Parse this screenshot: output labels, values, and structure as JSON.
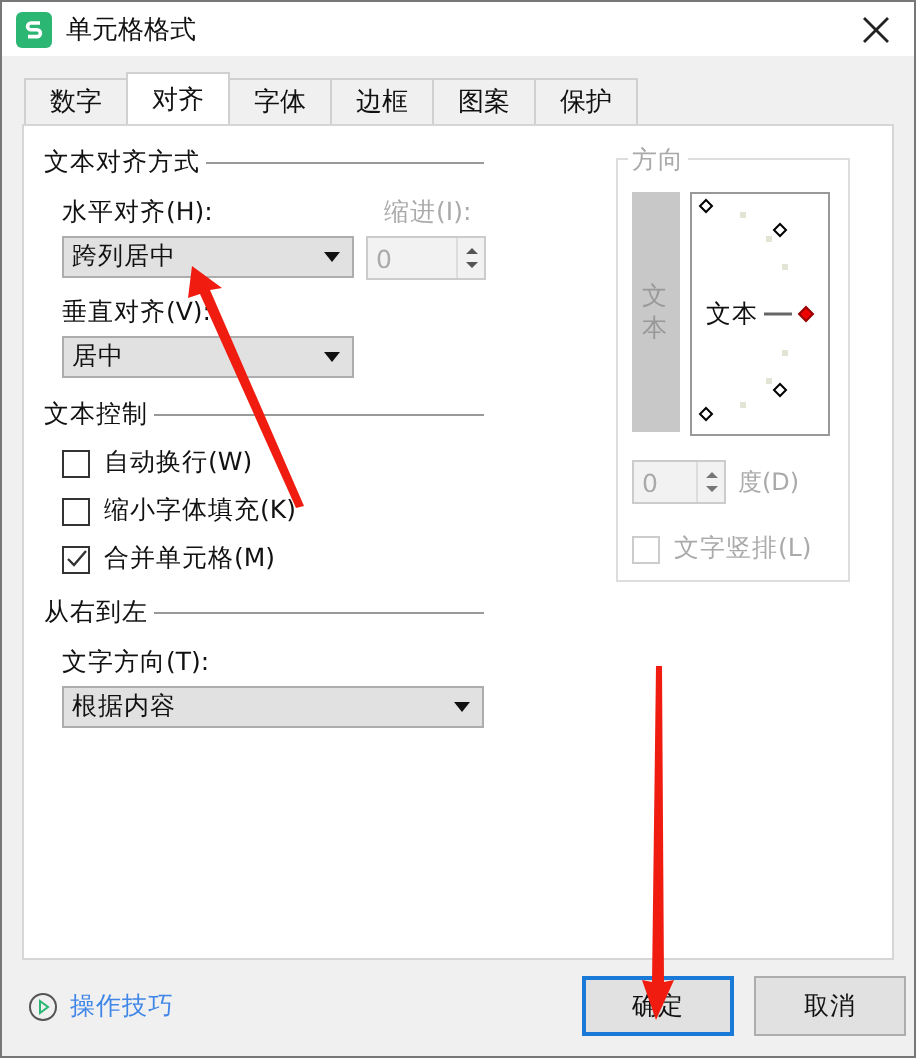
{
  "window": {
    "title": "单元格格式"
  },
  "tabs": [
    {
      "label": "数字",
      "selected": false
    },
    {
      "label": "对齐",
      "selected": true
    },
    {
      "label": "字体",
      "selected": false
    },
    {
      "label": "边框",
      "selected": false
    },
    {
      "label": "图案",
      "selected": false
    },
    {
      "label": "保护",
      "selected": false
    }
  ],
  "alignment": {
    "title": "文本对齐方式",
    "horizontal": {
      "label": "水平对齐(H):",
      "value": "跨列居中"
    },
    "indent": {
      "label": "缩进(I):",
      "value": "0",
      "disabled": true
    },
    "vertical": {
      "label": "垂直对齐(V):",
      "value": "居中"
    }
  },
  "text_control": {
    "title": "文本控制",
    "options": [
      {
        "label": "自动换行(W)",
        "checked": false
      },
      {
        "label": "缩小字体填充(K)",
        "checked": false
      },
      {
        "label": "合并单元格(M)",
        "checked": true
      }
    ]
  },
  "right_to_left": {
    "title": "从右到左",
    "direction": {
      "label": "文字方向(T):",
      "value": "根据内容"
    }
  },
  "orientation": {
    "title": "方向",
    "vertical_button": "文本",
    "dial_label": "文本",
    "degrees": {
      "value": "0",
      "label": "度(D)",
      "disabled": true
    },
    "vertical_text": {
      "label": "文字竖排(L)",
      "checked": false,
      "disabled": true
    }
  },
  "footer": {
    "tips": "操作技巧",
    "buttons": [
      {
        "label": "确定",
        "default": true
      },
      {
        "label": "取消",
        "default": false
      }
    ]
  }
}
